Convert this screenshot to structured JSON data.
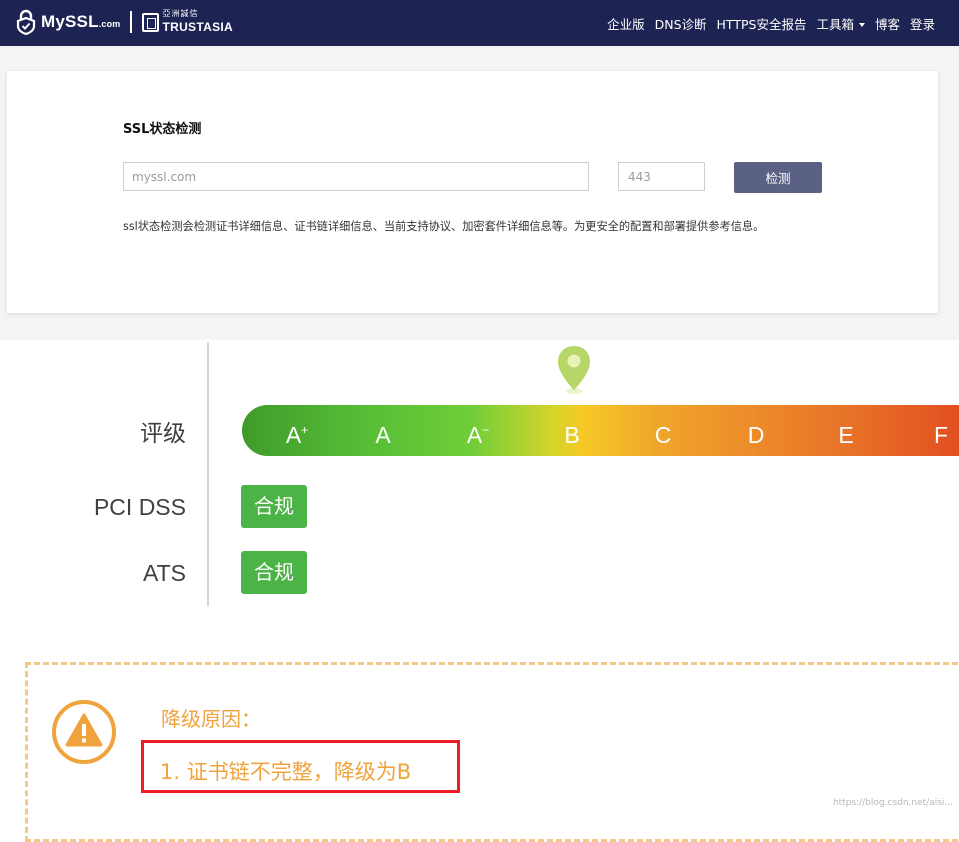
{
  "header": {
    "logo_text": "MySSL",
    "logo_suffix": ".com",
    "partner_logo_cn": "亞洲誠信",
    "partner_logo_en": "TRUSTASIA",
    "nav": [
      {
        "label": "企业版"
      },
      {
        "label": "DNS诊断"
      },
      {
        "label": "HTTPS安全报告"
      },
      {
        "label": "工具箱"
      },
      {
        "label": "博客"
      },
      {
        "label": "登录"
      }
    ]
  },
  "search": {
    "title": "SSL状态检测",
    "domain_placeholder": "myssl.com",
    "port_placeholder": "443",
    "button_label": "检测",
    "description": "ssl状态检测会检测证书详细信息、证书链详细信息、当前支持协议、加密套件详细信息等。为更安全的配置和部署提供参考信息。"
  },
  "rating": {
    "label": "评级",
    "current_grade": "B",
    "grades": [
      {
        "letter": "A",
        "mark": "+"
      },
      {
        "letter": "A",
        "mark": ""
      },
      {
        "letter": "A",
        "mark": "−"
      },
      {
        "letter": "B",
        "mark": ""
      },
      {
        "letter": "C",
        "mark": ""
      },
      {
        "letter": "D",
        "mark": ""
      },
      {
        "letter": "E",
        "mark": ""
      },
      {
        "letter": "F",
        "mark": ""
      }
    ],
    "pci": {
      "label": "PCI DSS",
      "status": "合规"
    },
    "ats": {
      "label": "ATS",
      "status": "合规"
    }
  },
  "downgrade": {
    "title": "降级原因：",
    "items": [
      "1. 证书链不完整，降级为B"
    ]
  },
  "watermark": "https://blog.csdn.net/aisi... ",
  "colors": {
    "nav_bg": "#1d2352",
    "button_bg": "#5b6185",
    "compliant_green": "#4cb347",
    "warning_orange": "#f0a33d",
    "highlight_red": "#ee1c24"
  }
}
